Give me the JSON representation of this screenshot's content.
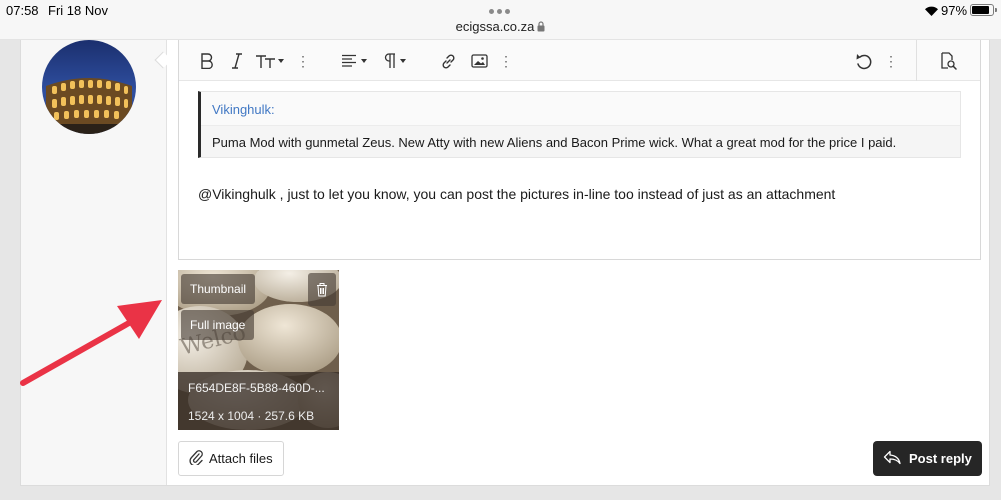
{
  "status_bar": {
    "time": "07:58",
    "date": "Fri 18 Nov",
    "url": "ecigssa.co.za",
    "battery": "97%",
    "battery_level": 0.97
  },
  "editor": {
    "toolbar_icons": [
      "bold-icon",
      "italic-icon",
      "text-size-icon",
      "more-icon",
      "align-icon",
      "paragraph-icon",
      "link-icon",
      "image-icon",
      "more-icon",
      "undo-icon",
      "more-icon",
      "preview-icon"
    ],
    "quote": {
      "author": "Vikinghulk:",
      "text": "Puma Mod with gunmetal Zeus. New Atty with new Aliens and Bacon Prime wick. What a great mod for the price I paid."
    },
    "message": "@Vikinghulk , just to let you know, you can post the pictures in-line too instead of just as an attachment"
  },
  "attachment": {
    "thumbnail_label": "Thumbnail",
    "full_image_label": "Full image",
    "filename": "F654DE8F-5B88-460D-...",
    "meta": "1524 x 1004 · 257.6 KB",
    "watermark": "Welco"
  },
  "buttons": {
    "attach_files": "Attach files",
    "post_reply": "Post reply"
  },
  "colors": {
    "quote_author": "#4178c4",
    "annotation_arrow": "#ea3346",
    "post_button": "#262626"
  }
}
